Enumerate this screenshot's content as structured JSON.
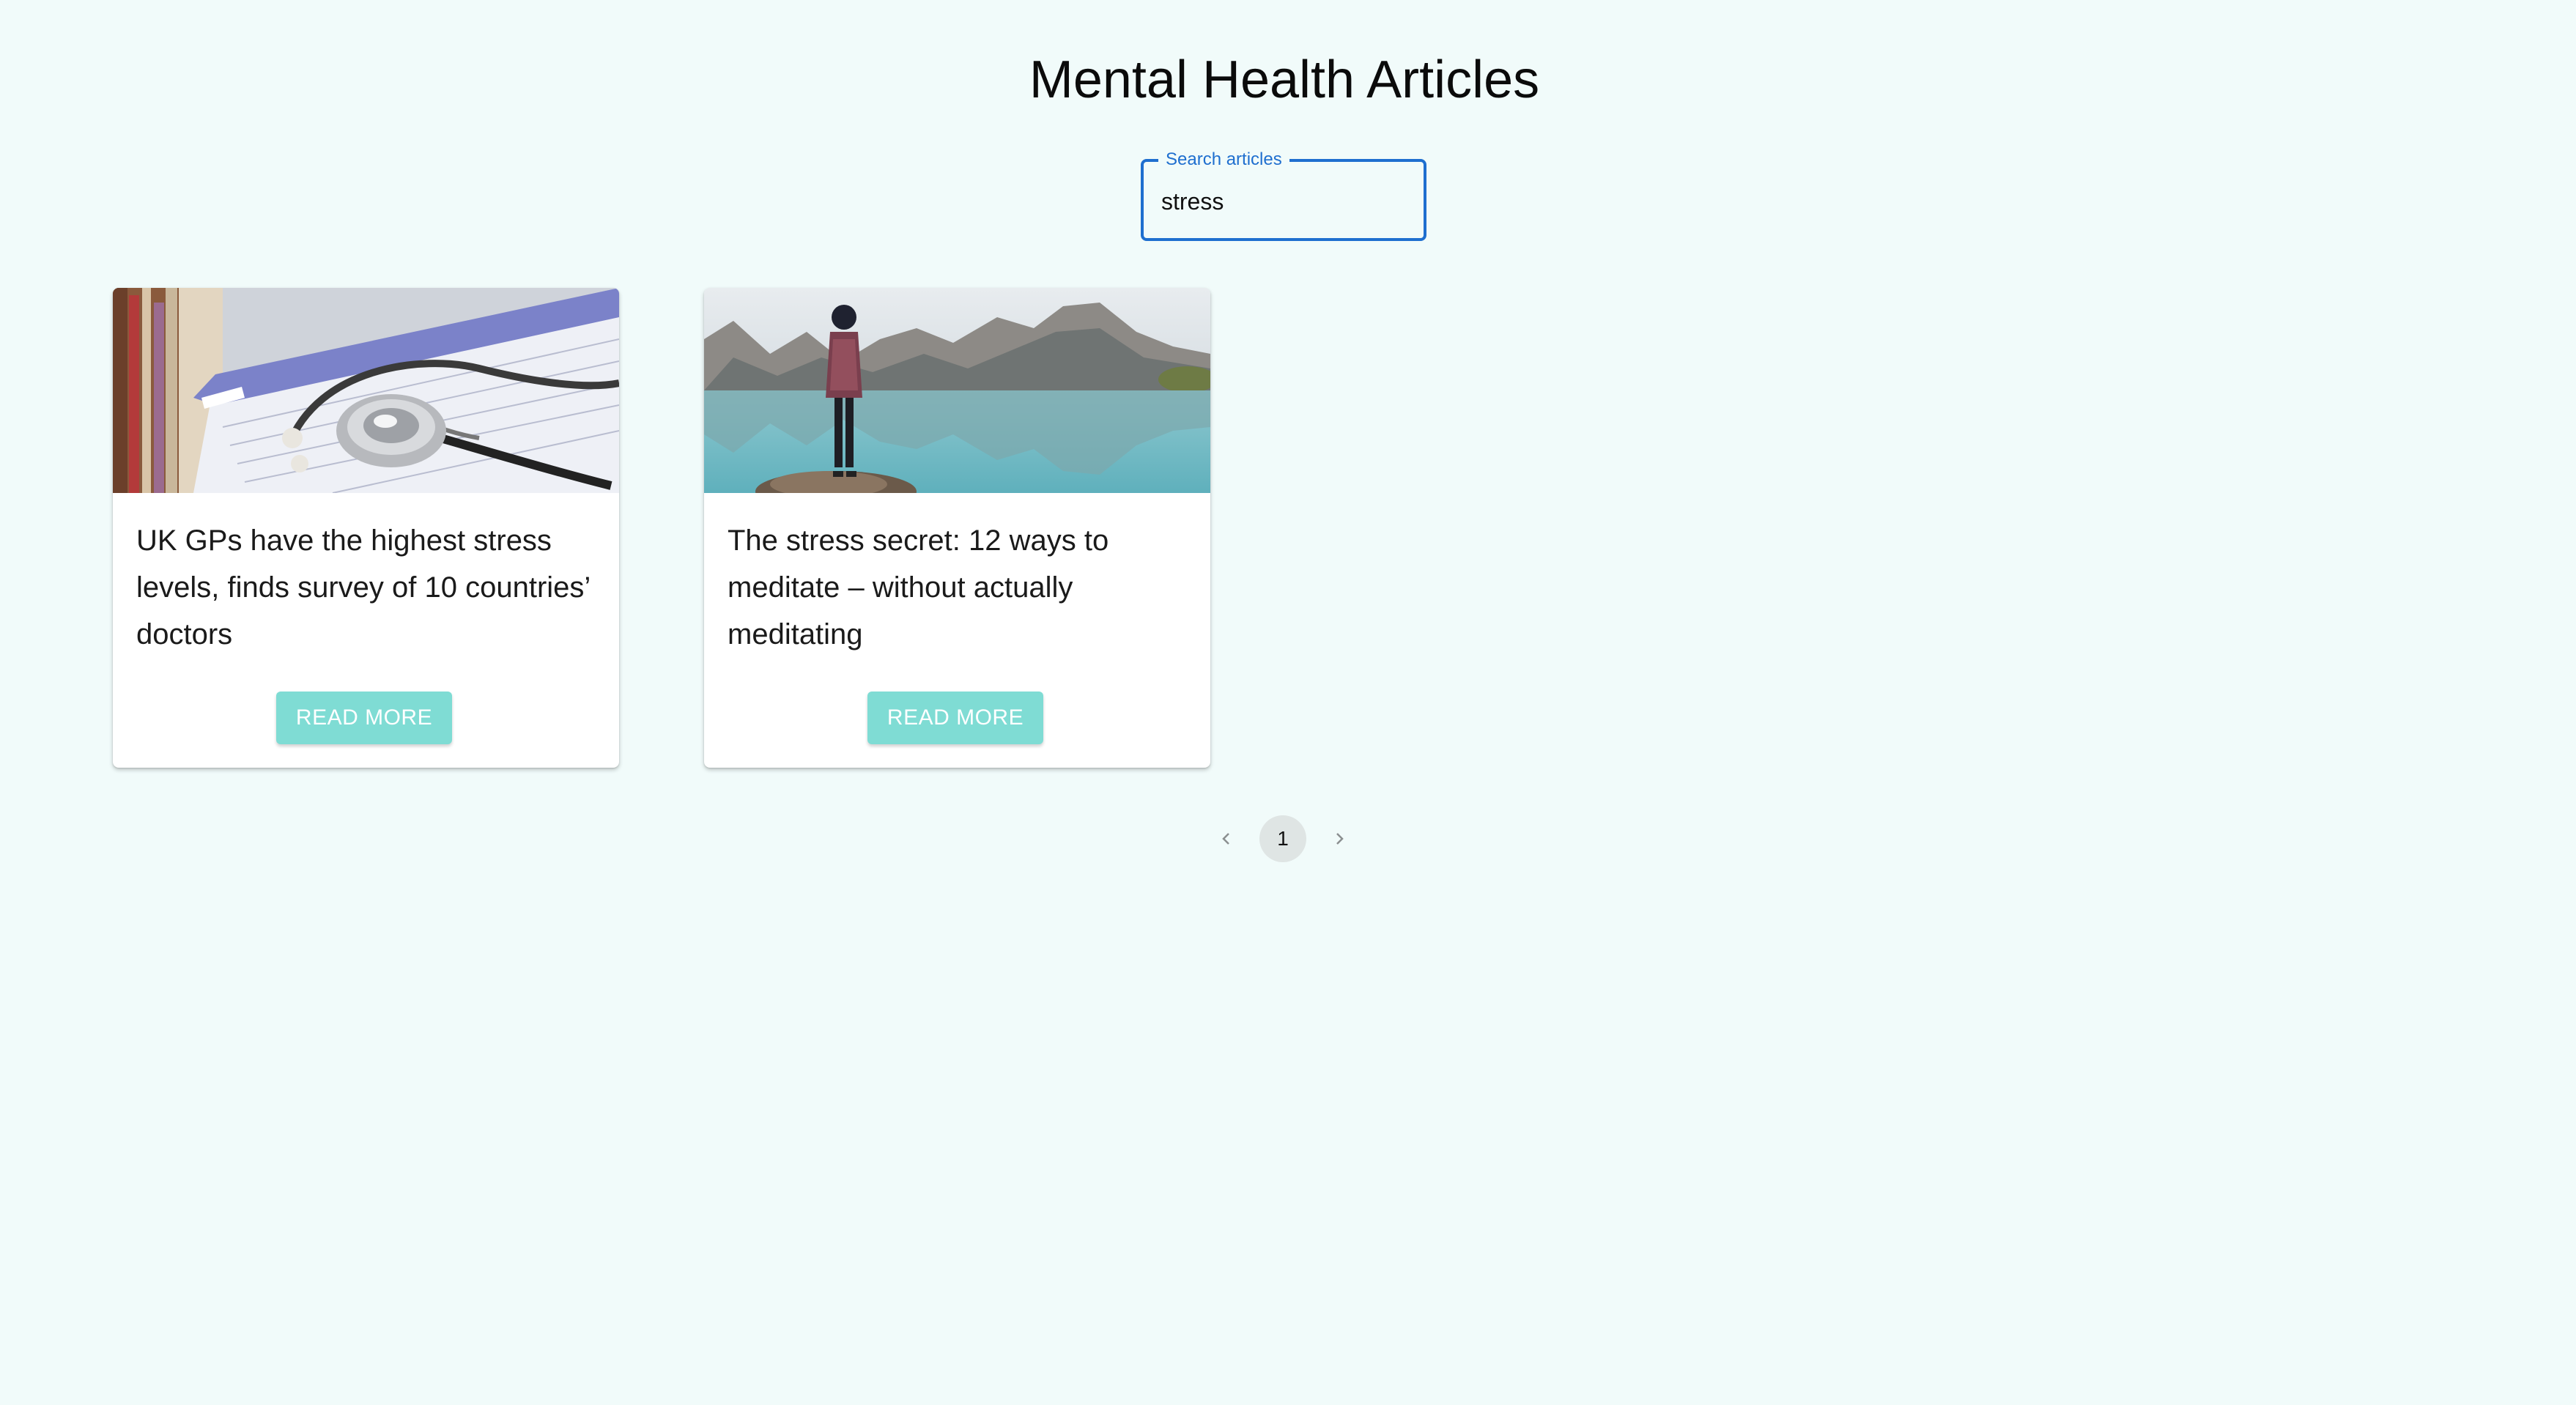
{
  "page": {
    "title": "Mental Health Articles"
  },
  "search": {
    "label": "Search articles",
    "value": "stress"
  },
  "articles": [
    {
      "title": "UK GPs have the highest stress levels, finds survey of 10 countries’ doctors",
      "image_icon": "stethoscope-on-form-image",
      "button_label": "READ MORE"
    },
    {
      "title": "The stress secret: 12 ways to meditate – without actually meditating",
      "image_icon": "person-by-mountain-lake-image",
      "button_label": "READ MORE"
    }
  ],
  "pagination": {
    "current_page": "1",
    "prev_icon": "chevron-left-icon",
    "next_icon": "chevron-right-icon"
  },
  "colors": {
    "background": "#f1fbfa",
    "accent": "#1f6fcf",
    "button": "#7fdcd4",
    "page_indicator": "#dfe5e4"
  }
}
